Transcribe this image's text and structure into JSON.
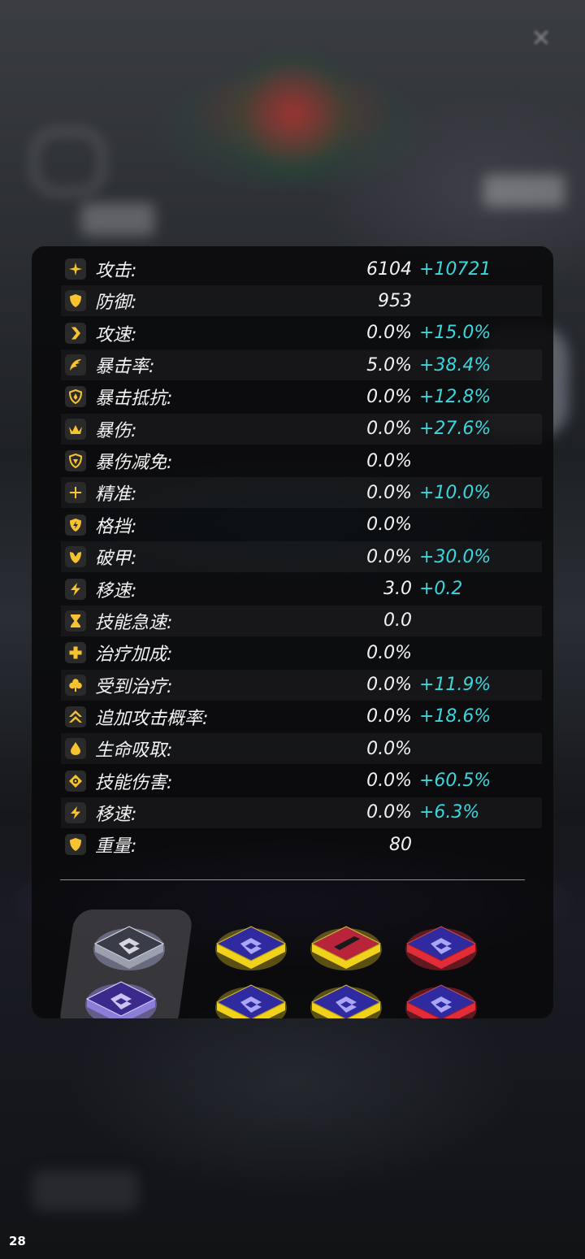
{
  "window": {
    "close_icon": "close-icon",
    "page_number": "28"
  },
  "colors": {
    "accent_bonus": "#3ad6dd",
    "icon_gold": "#f7c430",
    "text_primary": "#f2f2f2",
    "rarity_gold": "#f0d21c",
    "rarity_red": "#e32c38"
  },
  "stats": [
    {
      "label": "攻击:",
      "base": "6104",
      "bonus": "+10721",
      "icon": "sparkle-icon"
    },
    {
      "label": "防御:",
      "base": "953",
      "bonus": "",
      "icon": "shield-icon"
    },
    {
      "label": "攻速:",
      "base": "0.0%",
      "bonus": "+15.0%",
      "icon": "chevron-right-icon"
    },
    {
      "label": "暴击率:",
      "base": "5.0%",
      "bonus": "+38.4%",
      "icon": "claw-icon"
    },
    {
      "label": "暴击抵抗:",
      "base": "0.0%",
      "bonus": "+12.8%",
      "icon": "shield-crit-icon"
    },
    {
      "label": "暴伤:",
      "base": "0.0%",
      "bonus": "+27.6%",
      "icon": "crown-icon"
    },
    {
      "label": "暴伤减免:",
      "base": "0.0%",
      "bonus": "",
      "icon": "shield-reduce-icon"
    },
    {
      "label": "精准:",
      "base": "0.0%",
      "bonus": "+10.0%",
      "icon": "crosshair-icon"
    },
    {
      "label": "格挡:",
      "base": "0.0%",
      "bonus": "",
      "icon": "shield-bolt-icon"
    },
    {
      "label": "破甲:",
      "base": "0.0%",
      "bonus": "+30.0%",
      "icon": "broken-shield-icon"
    },
    {
      "label": "移速:",
      "base": "3.0",
      "bonus": "+0.2",
      "icon": "lightning-icon"
    },
    {
      "label": "技能急速:",
      "base": "0.0",
      "bonus": "",
      "icon": "hourglass-icon"
    },
    {
      "label": "治疗加成:",
      "base": "0.0%",
      "bonus": "",
      "icon": "plus-icon"
    },
    {
      "label": "受到治疗:",
      "base": "0.0%",
      "bonus": "+11.9%",
      "icon": "clover-icon"
    },
    {
      "label": "追加攻击概率:",
      "base": "0.0%",
      "bonus": "+18.6%",
      "icon": "double-chevron-up-icon"
    },
    {
      "label": "生命吸取:",
      "base": "0.0%",
      "bonus": "",
      "icon": "drop-icon"
    },
    {
      "label": "技能伤害:",
      "base": "0.0%",
      "bonus": "+60.5%",
      "icon": "target-icon"
    },
    {
      "label": "移速:",
      "base": "0.0%",
      "bonus": "+6.3%",
      "icon": "lightning-icon"
    },
    {
      "label": "重量:",
      "base": "80",
      "bonus": "",
      "icon": "shield-icon"
    }
  ],
  "equipment": [
    {
      "slot": "core-1",
      "rarity": "silver"
    },
    {
      "slot": "core-2",
      "rarity": "purple"
    },
    {
      "slot": "item-1",
      "rarity": "gold"
    },
    {
      "slot": "item-2",
      "rarity": "gold-special"
    },
    {
      "slot": "item-3",
      "rarity": "red"
    },
    {
      "slot": "item-4",
      "rarity": "gold"
    },
    {
      "slot": "item-5",
      "rarity": "gold"
    },
    {
      "slot": "item-6",
      "rarity": "red"
    }
  ]
}
